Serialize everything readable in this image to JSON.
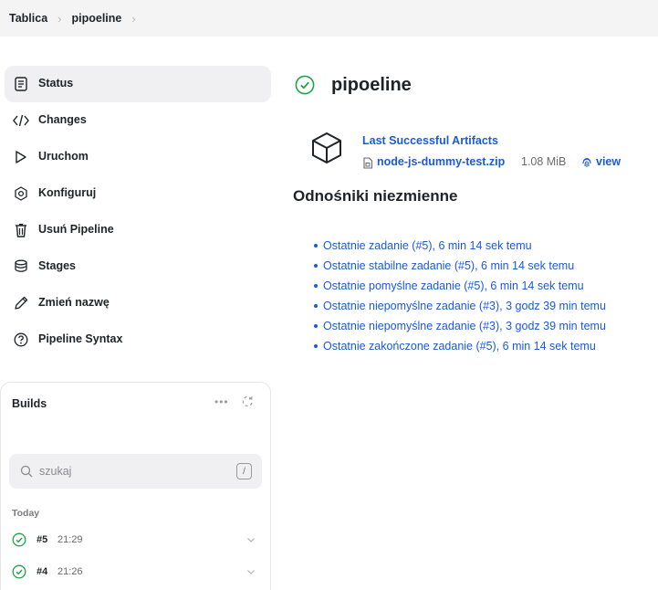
{
  "breadcrumb": [
    {
      "label": "Tablica"
    },
    {
      "label": "pipoeline"
    }
  ],
  "sidebar": {
    "items": [
      {
        "label": "Status",
        "icon": "document-icon",
        "active": true
      },
      {
        "label": "Changes",
        "icon": "code-icon"
      },
      {
        "label": "Uruchom",
        "icon": "play-icon"
      },
      {
        "label": "Konfiguruj",
        "icon": "gear-icon"
      },
      {
        "label": "Usuń Pipeline",
        "icon": "trash-icon"
      },
      {
        "label": "Stages",
        "icon": "layers-icon"
      },
      {
        "label": "Zmień nazwę",
        "icon": "pencil-icon"
      },
      {
        "label": "Pipeline Syntax",
        "icon": "help-icon"
      }
    ]
  },
  "builds": {
    "title": "Builds",
    "search_placeholder": "szukaj",
    "shortcut": "/",
    "group_label": "Today",
    "rows": [
      {
        "number": "#5",
        "time": "21:29",
        "status": "success"
      },
      {
        "number": "#4",
        "time": "21:26",
        "status": "success"
      }
    ]
  },
  "main": {
    "title": "pipoeline",
    "artifacts": {
      "heading": "Last Successful Artifacts",
      "file_name": "node-js-dummy-test.zip",
      "file_size": "1.08 MiB",
      "view_label": "view"
    },
    "permalinks_title": "Odnośniki niezmienne",
    "permalinks": [
      "Ostatnie zadanie (#5), 6 min 14 sek temu",
      "Ostatnie stabilne zadanie (#5), 6 min 14 sek temu",
      "Ostatnie pomyślne zadanie (#5), 6 min 14 sek temu",
      "Ostatnie niepomyślne zadanie (#3), 3 godz 39 min temu",
      "Ostatnie niepomyślne zadanie (#3), 3 godz 39 min temu",
      "Ostatnie zakończone zadanie (#5), 6 min 14 sek temu"
    ]
  },
  "colors": {
    "link": "#1a5bd6",
    "success": "#1ea446",
    "active_bg": "#f0f0f2",
    "topbar_bg": "#f4f4f5"
  }
}
